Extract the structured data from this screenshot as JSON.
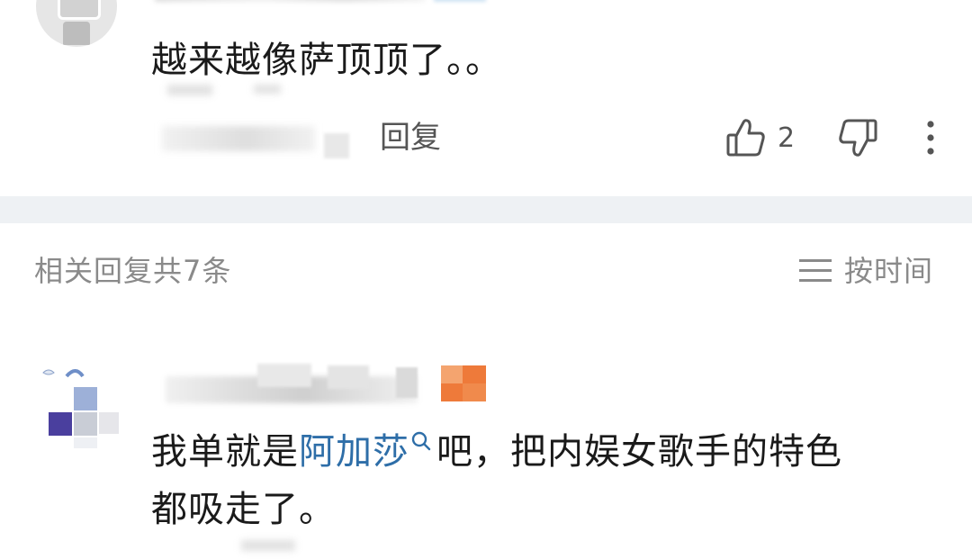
{
  "top_comment": {
    "text": "越来越像萨顶顶了。。",
    "reply_label": "回复",
    "like_count": "2"
  },
  "related": {
    "title": "相关回复共7条",
    "sort_label": "按时间"
  },
  "reply": {
    "text_before_link": "我单就是",
    "link_text": "阿加莎",
    "text_after_link_line1": "吧，把内娱女歌手的特色",
    "text_line2": "都吸走了。"
  },
  "colors": {
    "link": "#2e6ea8",
    "divider": "#eef1f4",
    "muted_text": "#8a8a8a",
    "badge_orange": "#ee7a3a"
  },
  "icons": [
    "thumbs-up-icon",
    "thumbs-down-icon",
    "more-vertical-icon",
    "sort-lines-icon",
    "search-icon"
  ]
}
